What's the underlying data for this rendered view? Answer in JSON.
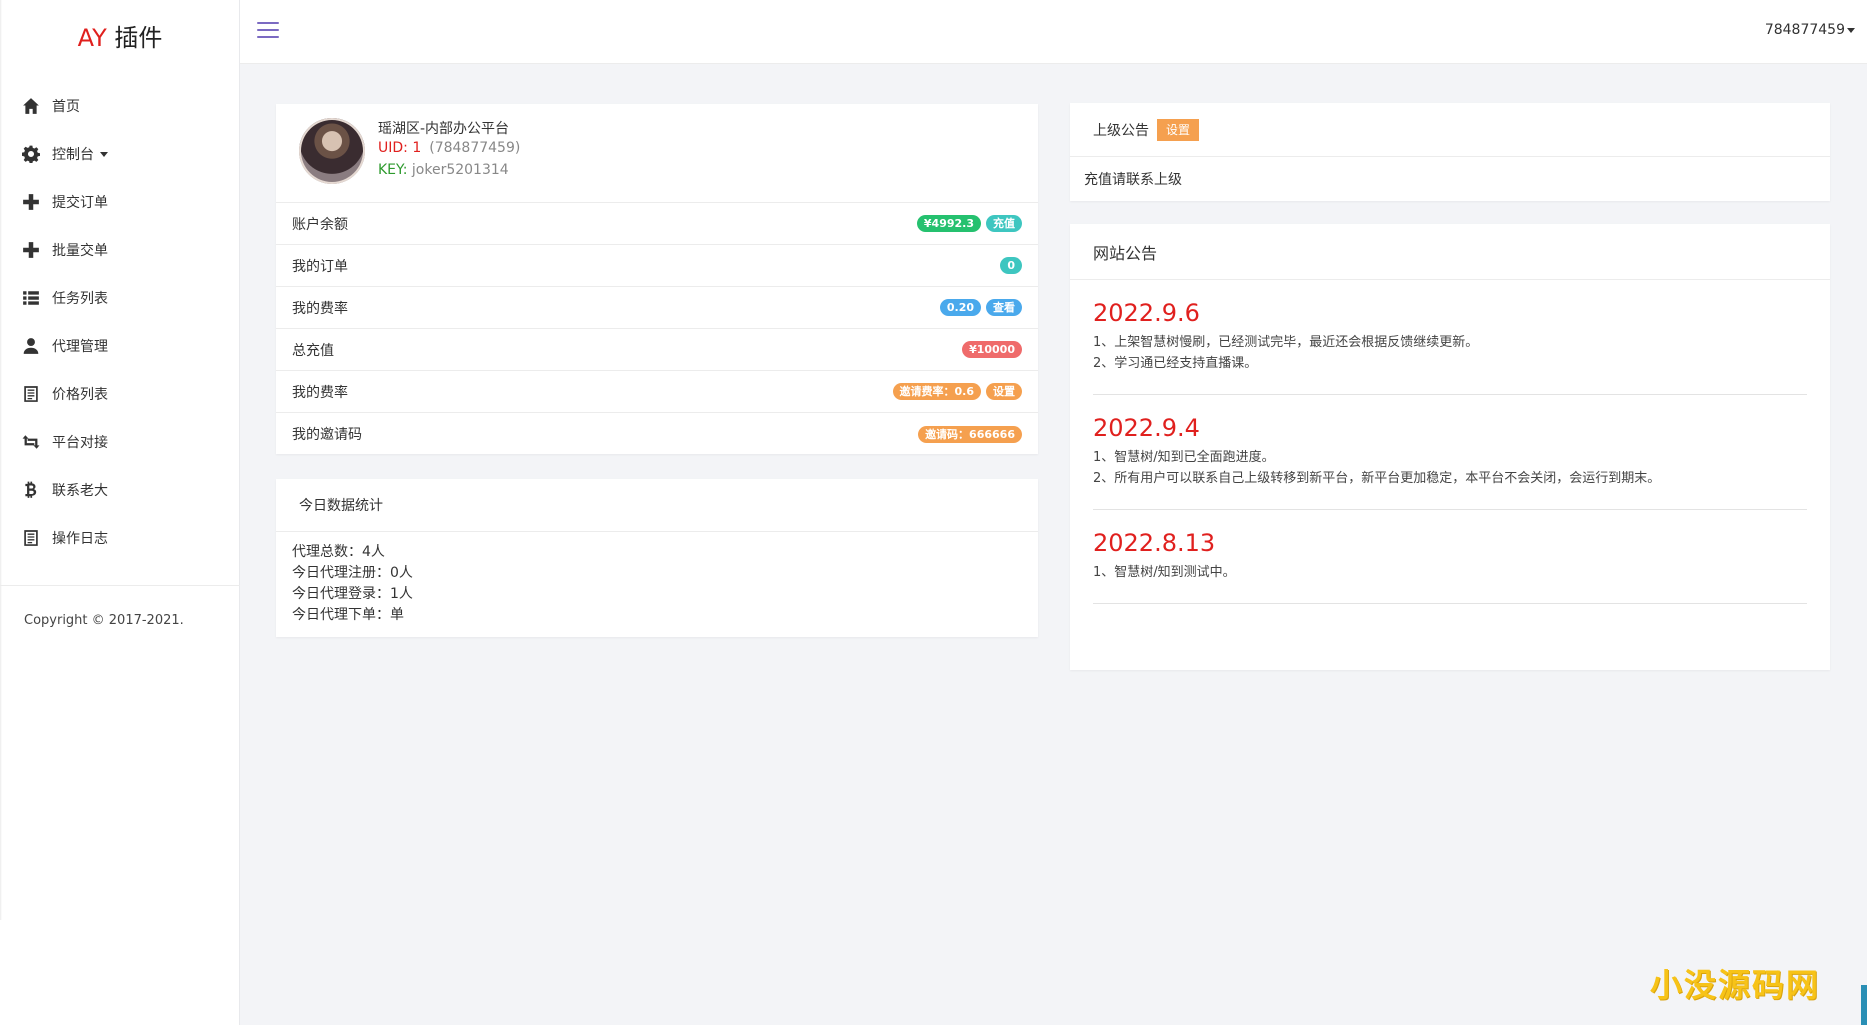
{
  "app": {
    "logo_prefix": "AY",
    "logo_suffix": " 插件"
  },
  "sidebar": {
    "items": [
      {
        "label": "首页",
        "icon": "home-icon"
      },
      {
        "label": "控制台",
        "icon": "gear-icon"
      },
      {
        "label": "提交订单",
        "icon": "plus-icon"
      },
      {
        "label": "批量交单",
        "icon": "plus-icon"
      },
      {
        "label": "任务列表",
        "icon": "list-icon"
      },
      {
        "label": "代理管理",
        "icon": "user-icon"
      },
      {
        "label": "价格列表",
        "icon": "document-icon"
      },
      {
        "label": "平台对接",
        "icon": "retweet-icon"
      },
      {
        "label": "联系老大",
        "icon": "bitcoin-icon"
      },
      {
        "label": "操作日志",
        "icon": "document-icon"
      }
    ],
    "copyright": "Copyright © 2017-2021."
  },
  "header": {
    "username": "784877459"
  },
  "profile": {
    "name": "瑶湖区-内部办公平台",
    "uid_label": "UID: 1",
    "uid_value": "(784877459)",
    "key_label": "KEY:",
    "key_value": " joker5201314",
    "rows": [
      {
        "label": "账户余额",
        "badges": [
          "¥4992.3",
          "充值"
        ]
      },
      {
        "label": "我的订单",
        "badges": [
          "0"
        ]
      },
      {
        "label": "我的费率",
        "badges": [
          "0.20",
          "查看"
        ]
      },
      {
        "label": "总充值",
        "badges": [
          "¥10000"
        ]
      },
      {
        "label": "我的费率",
        "badges": [
          "邀请费率：0.6",
          "设置"
        ]
      },
      {
        "label": "我的邀请码",
        "badges": [
          "邀请码：666666"
        ]
      }
    ]
  },
  "stats": {
    "title": "今日数据统计",
    "lines": [
      "代理总数：4人",
      "今日代理注册：0人",
      "今日代理登录：1人",
      "今日代理下单：单"
    ]
  },
  "upper_notice": {
    "title": "上级公告",
    "button": "设置",
    "body": "充值请联系上级"
  },
  "site_notice": {
    "title": "网站公告",
    "entries": [
      {
        "date": "2022.9.6",
        "lines": [
          "1、上架智慧树慢刷，已经测试完毕，最近还会根据反馈继续更新。",
          "2、学习通已经支持直播课。"
        ]
      },
      {
        "date": "2022.9.4",
        "lines": [
          "1、智慧树/知到已全面跑进度。",
          "2、所有用户可以联系自己上级转移到新平台，新平台更加稳定，本平台不会关闭，会运行到期末。"
        ]
      },
      {
        "date": "2022.8.13",
        "lines": [
          "1、智慧树/知到测试中。"
        ]
      }
    ]
  },
  "watermark": "小没源码网",
  "colors": {
    "accent_red": "#e0201e",
    "green": "#25c16f",
    "teal": "#3ec6c0",
    "blue": "#4aa9ec",
    "red": "#ef6b6b",
    "orange": "#f5a04f",
    "hamburger": "#7b6ac2"
  }
}
